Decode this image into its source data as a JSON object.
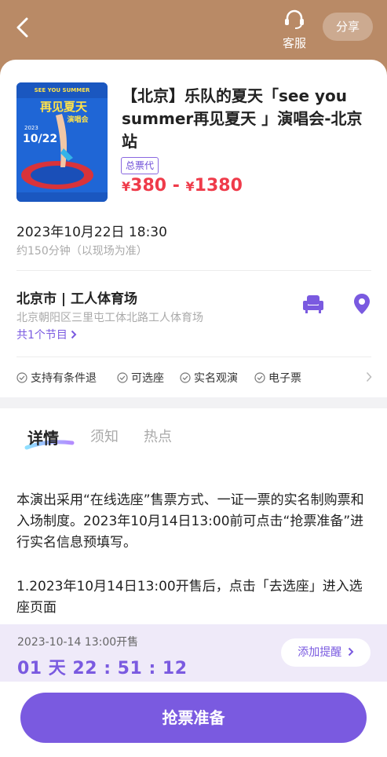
{
  "header": {
    "customer_service_label": "客服",
    "share_label": "分享",
    "icons": {
      "back": "chevron-left-icon",
      "customer_service": "headset-icon"
    }
  },
  "event": {
    "title": "【北京】乐队的夏天「see you summer再见夏天 」演唱会-北京站",
    "agent_tag": "总票代",
    "price_min_symbol": "¥",
    "price_min": "380",
    "price_sep": " - ",
    "price_max_symbol": "¥",
    "price_max": "1380",
    "datetime": "2023年10月22日 18:30",
    "duration": "约150分钟（以现场为准）",
    "venue": "北京市 | 工人体育场",
    "address": "北京朝阳区三里屯工体北路工人体育场",
    "programs": "共1个节目",
    "features": [
      "支持有条件退",
      "可选座",
      "实名观演",
      "电子票"
    ],
    "poster": {
      "brand_line": "SEE YOU SUMMER",
      "title_line": "再见夏天",
      "subtitle_line": "演唱会",
      "date": "10/22",
      "year": "2023"
    }
  },
  "tabs": [
    "详情",
    "须知",
    "热点"
  ],
  "details": {
    "paragraph1": "本演出采用“在线选座”售票方式、一证一票的实名制购票和入场制度。2023年10月14日13:00前可点击“抢票准备”进行实名信息预填写。",
    "paragraph2": "1.2023年10月14日13:00开售后，点击「去选座」进入选座页面"
  },
  "sale": {
    "time_label": "2023-10-14 13:00开售",
    "countdown": "01 天 22 : 51 : 12",
    "remind_label": "添加提醒"
  },
  "action": {
    "main_button": "抢票准备"
  },
  "colors": {
    "header_bg": "#b98a66",
    "accent": "#7a5ae0",
    "price": "#ef3b4a",
    "sale_bar_bg": "#efeaf9"
  }
}
